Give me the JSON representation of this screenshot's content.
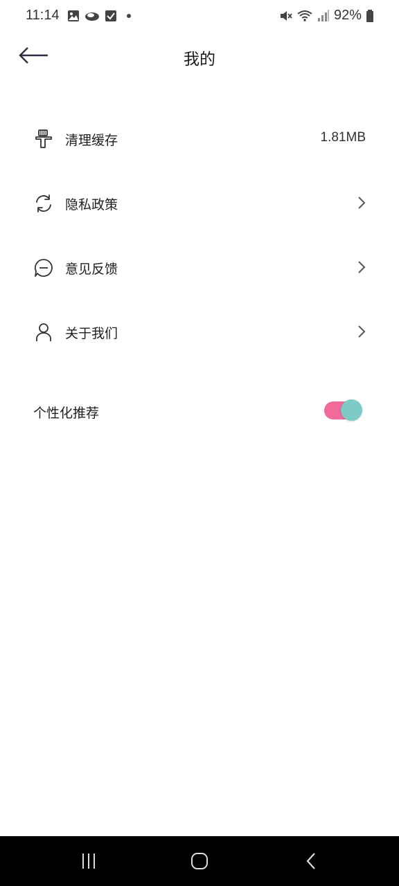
{
  "status_bar": {
    "time": "11:14",
    "battery": "92%",
    "left_icons": [
      "image-icon",
      "cloud-icon",
      "checkbox-icon",
      "dot-icon"
    ],
    "right_icons": [
      "mute-icon",
      "wifi-icon",
      "signal-icon",
      "battery-icon"
    ]
  },
  "header": {
    "title": "我的",
    "back_icon": "arrow-left-icon"
  },
  "menu": {
    "items": [
      {
        "label": "清理缓存",
        "value": "1.81MB",
        "icon": "broom-icon"
      },
      {
        "label": "隐私政策",
        "icon": "refresh-icon",
        "chevron": "chevron-right-icon"
      },
      {
        "label": "意见反馈",
        "icon": "chat-icon",
        "chevron": "chevron-right-icon"
      },
      {
        "label": "关于我们",
        "icon": "user-icon",
        "chevron": "chevron-right-icon"
      }
    ]
  },
  "preferences": {
    "personalized_label": "个性化推荐",
    "personalized_enabled": true
  },
  "colors": {
    "toggle_track": "#f06a9b",
    "toggle_thumb": "#7ecac4",
    "nav_bar": "#000000"
  },
  "nav_bar": {
    "buttons": [
      "recents-icon",
      "home-icon",
      "back-icon"
    ]
  }
}
